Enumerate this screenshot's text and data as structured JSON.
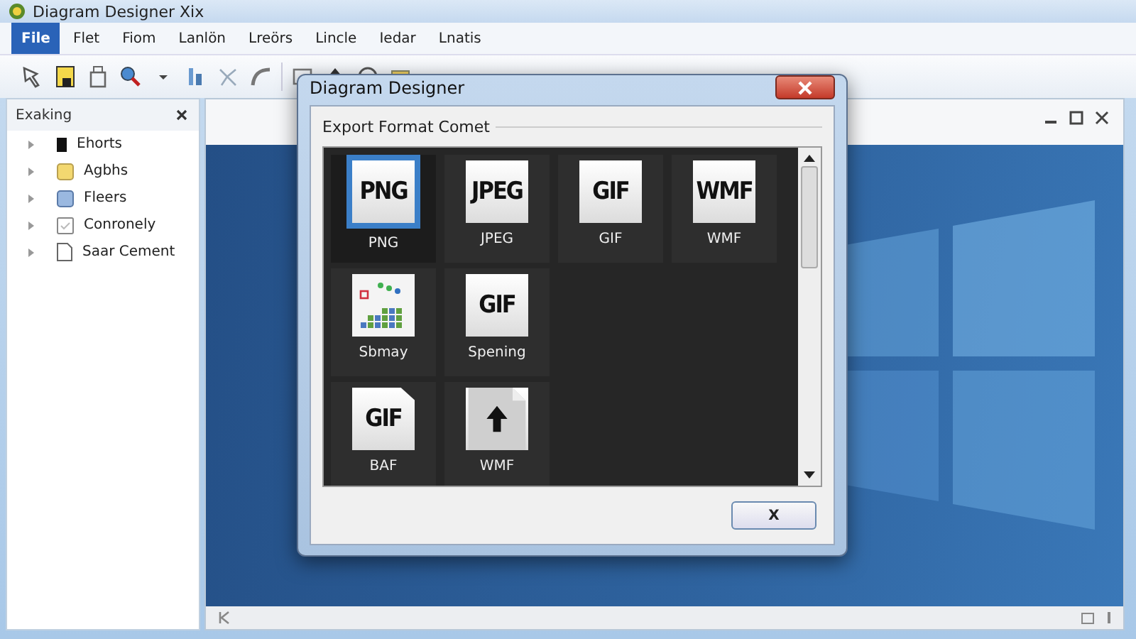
{
  "window": {
    "title": "Diagram Designer Xix"
  },
  "menu": [
    {
      "label": "File",
      "selected": true
    },
    {
      "label": "Flet",
      "selected": false
    },
    {
      "label": "Fiom",
      "selected": false
    },
    {
      "label": "Lanlön",
      "selected": false
    },
    {
      "label": "Lreörs",
      "selected": false
    },
    {
      "label": "Lincle",
      "selected": false
    },
    {
      "label": "Iedar",
      "selected": false
    },
    {
      "label": "Lnatis",
      "selected": false
    }
  ],
  "sidebar": {
    "title": "Exaking",
    "items": [
      {
        "label": "Ehorts",
        "kind": "block",
        "expanded": false
      },
      {
        "label": "Agbhs",
        "kind": "folder",
        "expanded": false
      },
      {
        "label": "Fleers",
        "kind": "box",
        "expanded": false
      },
      {
        "label": "Conronely",
        "kind": "check",
        "expanded": false
      },
      {
        "label": "Saar Cement",
        "kind": "page",
        "expanded": false
      }
    ]
  },
  "dialog": {
    "title": "Diagram Designer",
    "group_label": "Export Format Comet",
    "format_rows": [
      [
        {
          "kind": "text",
          "icon_text": "PNG",
          "label": "PNG",
          "selected": true
        },
        {
          "kind": "text",
          "icon_text": "JPEG",
          "label": "JPEG",
          "selected": false
        },
        {
          "kind": "text",
          "icon_text": "GIF",
          "label": "GIF",
          "selected": false
        },
        {
          "kind": "text",
          "icon_text": "WMF",
          "label": "WMF",
          "selected": false
        }
      ],
      [
        {
          "kind": "chart",
          "label": "Sbmay",
          "selected": false
        },
        {
          "kind": "text",
          "icon_text": "GIF",
          "label": "Spening",
          "selected": false
        }
      ],
      [
        {
          "kind": "file",
          "icon_text": "GIF",
          "label": "BAF",
          "selected": false
        },
        {
          "kind": "upload",
          "label": "WMF",
          "selected": false
        }
      ]
    ],
    "button": "X"
  }
}
